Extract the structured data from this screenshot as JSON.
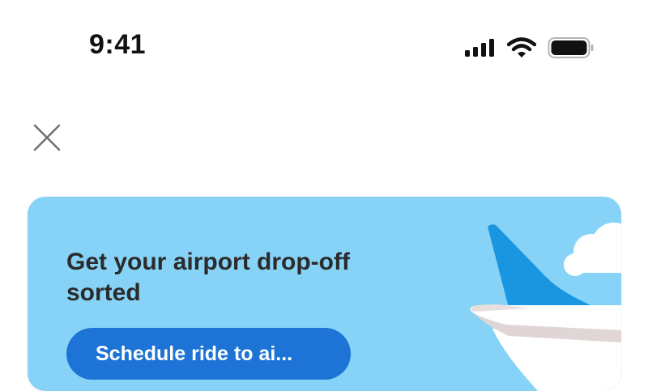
{
  "status_bar": {
    "time": "9:41",
    "icons": [
      "cellular-signal-icon",
      "wifi-icon",
      "battery-icon"
    ]
  },
  "header": {
    "close_icon": "close-icon"
  },
  "promo": {
    "title": "Get your airport drop-off sorted",
    "button_label": "Schedule ride to ai...",
    "background_color": "#87d3f7",
    "button_color": "#1d74d6",
    "illustration": "airplane-icon"
  }
}
